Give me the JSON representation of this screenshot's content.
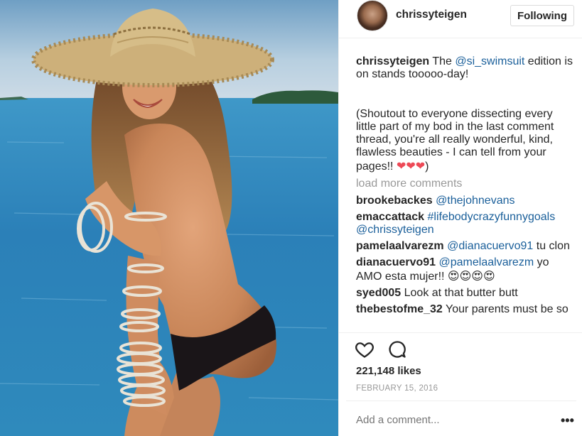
{
  "post": {
    "username": "chrissyteigen",
    "follow_label": "Following",
    "caption": {
      "username": "chrissyteigen",
      "part1": " The ",
      "mention": "@si_swimsuit",
      "part2": " edition is on stands tooooo-day!",
      "part3": "(Shoutout to everyone dissecting every little part of my bod in the last comment thread, you're all really wonderful, kind, flawless beauties - I can tell from your pages!! ",
      "emoji": "❤❤❤",
      "part4": ")"
    },
    "load_more": "load more comments",
    "comments": [
      {
        "user": "brookebackes",
        "link": "@thejohnevans",
        "text": ""
      },
      {
        "user": "emaccattack",
        "link": "#lifebodycrazyfunnygoals @chrissyteigen",
        "text": ""
      },
      {
        "user": "pamelaalvarezm",
        "link": "@dianacuervo91",
        "text": " tu clon"
      },
      {
        "user": "dianacuervo91",
        "link": "@pamelaalvarezm",
        "text": " yo AMO esta mujer!! 😍😍😍😍"
      },
      {
        "user": "syed005",
        "link": "",
        "text": " Look at that butter butt"
      },
      {
        "user": "thebestofme_32",
        "link": "",
        "text": " Your parents must be so"
      }
    ],
    "likes": "221,148 likes",
    "date": "FEBRUARY 15, 2016",
    "add_comment_placeholder": "Add a comment...",
    "more_label": "•••",
    "icons": {
      "like": "heart-outline-icon",
      "comment": "speech-bubble-icon",
      "more": "ellipsis-icon"
    },
    "colors": {
      "link": "#1a5f9a",
      "muted": "#999999",
      "text": "#262626",
      "heart": "#ed4956"
    }
  }
}
